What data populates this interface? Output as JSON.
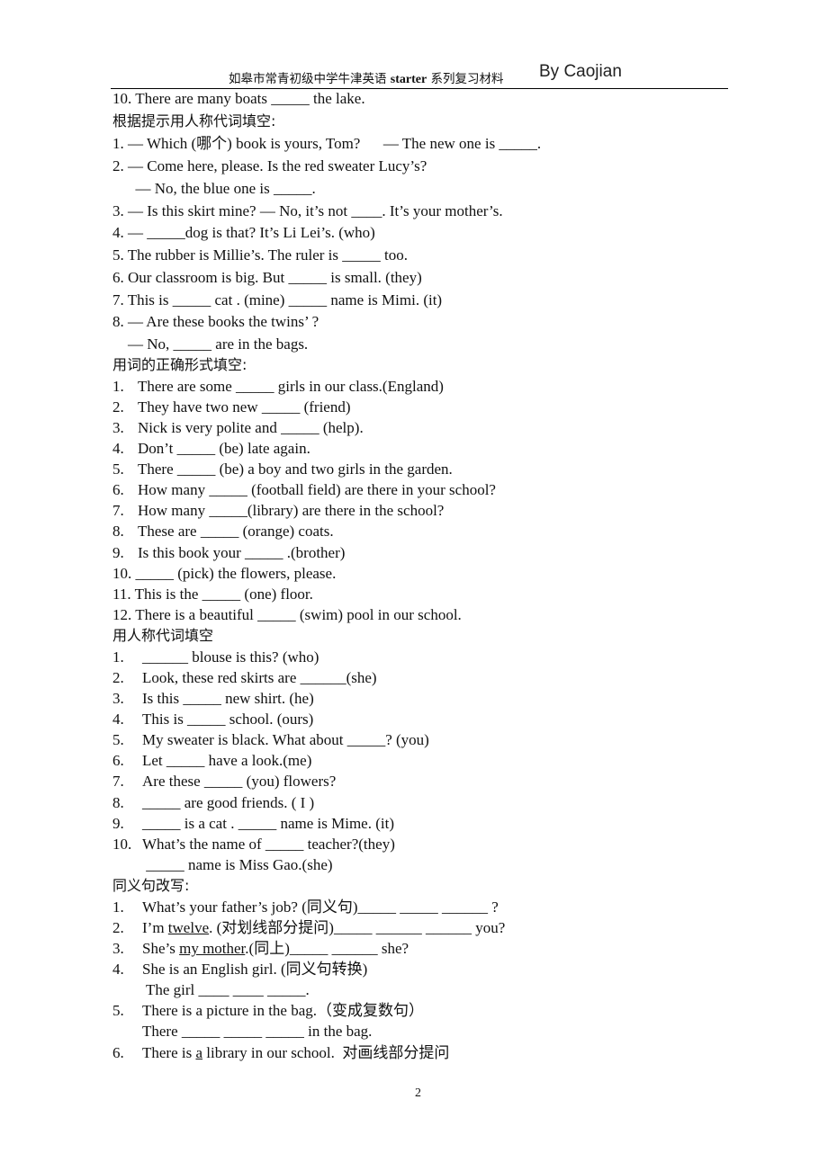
{
  "header": {
    "title_cn_1": "如皋市常青初级中学牛津英语 ",
    "title_en": "starter",
    "title_cn_2": " 系列复习材料",
    "author": "By Caojian"
  },
  "carry_over": "10. There are many boats _____ the lake.",
  "sections": [
    {
      "heading": "根据提示用人称代词填空:",
      "items": [
        "1. — Which (哪个) book is yours, Tom?      — The new one is _____.",
        "2. — Come here, please. Is the red sweater Lucy’s?",
        "      — No, the blue one is _____.",
        "3. — Is this skirt mine? — No, it’s not ____. It’s your mother’s.",
        "4. — _____dog is that? It’s Li Lei’s. (who)",
        "5. The rubber is Millie’s. The ruler is _____ too.",
        "6. Our classroom is big. But _____ is small. (they)",
        "7. This is _____ cat . (mine) _____ name is Mimi. (it)",
        "8. — Are these books the twins’ ?",
        "    — No, _____ are in the bags."
      ]
    },
    {
      "heading": "用词的正确形式填空:",
      "items": [
        {
          "n": "1.",
          "t": "There are some _____ girls in our class.(England)"
        },
        {
          "n": "2.",
          "t": "They have two new _____ (friend)"
        },
        {
          "n": "3.",
          "t": "Nick is very polite and _____ (help)."
        },
        {
          "n": "4.",
          "t": "Don’t _____ (be) late again."
        },
        {
          "n": "5.",
          "t": "There _____ (be) a boy and two girls in the garden."
        },
        {
          "n": "6.",
          "t": "How many _____ (football field) are there in your school?"
        },
        {
          "n": "7.",
          "t": "How many _____(library) are there in the school?"
        },
        {
          "n": "8.",
          "t": "These are _____ (orange) coats."
        },
        {
          "n": "9.",
          "t": "Is this book your _____ .(brother)"
        },
        {
          "n": "10.",
          "t": "_____ (pick) the flowers, please."
        },
        {
          "n": "11.",
          "t": "This is the _____ (one) floor."
        },
        {
          "n": "12.",
          "t": "There is a beautiful _____ (swim) pool in our school."
        }
      ]
    },
    {
      "heading": "用人称代词填空",
      "items": [
        {
          "n": "1.",
          "t": "______ blouse is this? (who)"
        },
        {
          "n": "2.",
          "t": "Look, these red skirts are ______(she)"
        },
        {
          "n": "3.",
          "t": "Is this _____ new shirt. (he)"
        },
        {
          "n": "4.",
          "t": "This is _____ school. (ours)"
        },
        {
          "n": "5.",
          "t": "My sweater is black. What about _____? (you)"
        },
        {
          "n": "6.",
          "t": "Let _____ have a look.(me)"
        },
        {
          "n": "7.",
          "t": "Are these _____ (you) flowers?"
        },
        {
          "n": "8.",
          "t": "_____ are good friends. ( I )"
        },
        {
          "n": "9.",
          "t": "_____ is a cat . _____ name is Mime. (it)"
        },
        {
          "n": "10.",
          "t": "What’s the name of _____ teacher?(they)"
        },
        {
          "n": "",
          "t": " _____ name is Miss Gao.(she)"
        }
      ]
    },
    {
      "heading": "同义句改写:",
      "items": [
        {
          "n": "1.",
          "pre": "What’s your father’s job? (同义句)_____ _____ ______ ?",
          "u": "",
          "post": ""
        },
        {
          "n": "2.",
          "pre": "I’m ",
          "u": "twelve",
          "post": ". (对划线部分提问)_____ ______ ______ you?"
        },
        {
          "n": "3.",
          "pre": "She’s ",
          "u": "my mother",
          "post": ".(同上)_____ ______ she?"
        },
        {
          "n": "4.",
          "pre": "She is an English girl. (同义句转换)",
          "u": "",
          "post": ""
        },
        {
          "n": "",
          "pre": " The girl ____ ____ _____.",
          "u": "",
          "post": ""
        },
        {
          "n": "5.",
          "pre": "There is a picture in the bag.（变成复数句）",
          "u": "",
          "post": ""
        },
        {
          "n": "",
          "pre": "There _____ _____ _____ in the bag.",
          "u": "",
          "post": ""
        },
        {
          "n": "6.",
          "pre": "There is ",
          "u": "a",
          "post": " library in our school.  对画线部分提问"
        }
      ]
    }
  ],
  "page_number": "2"
}
